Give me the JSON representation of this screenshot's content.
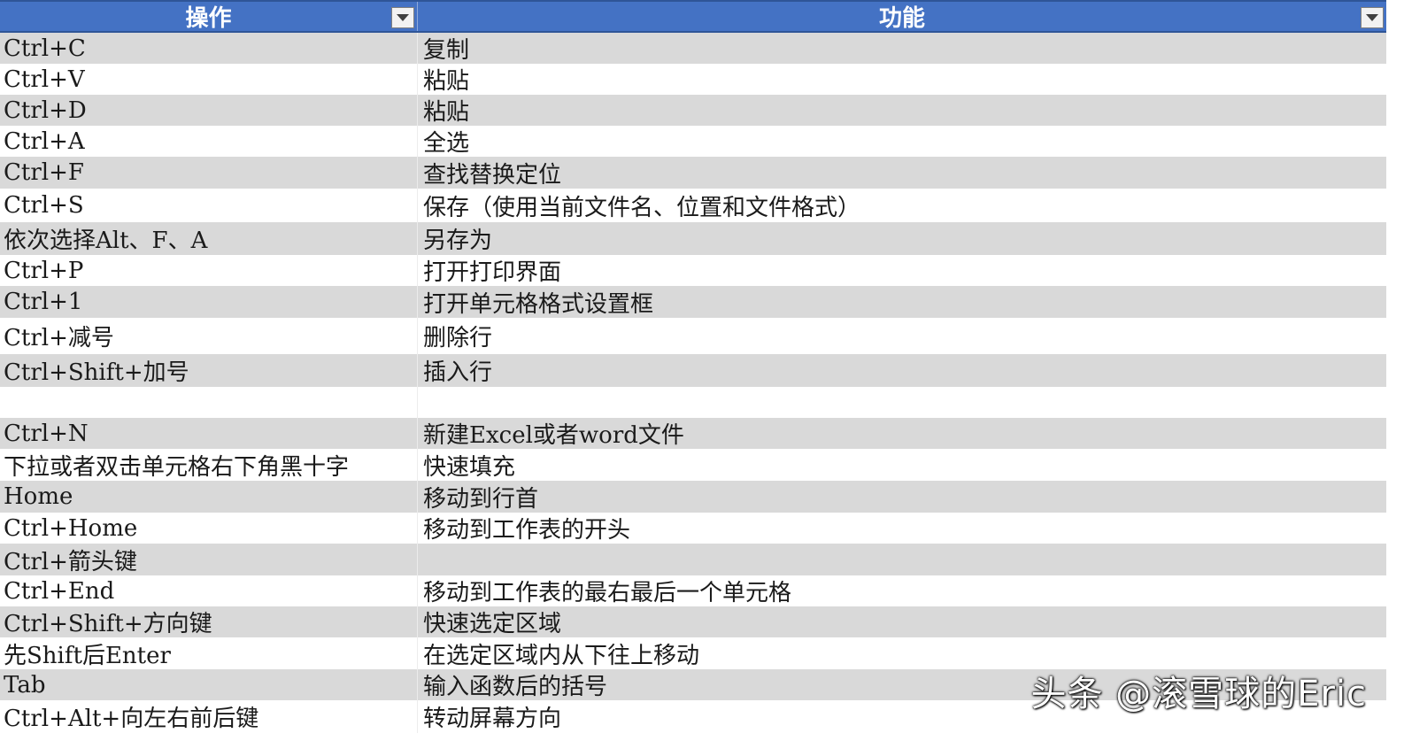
{
  "header": {
    "col1": "操作",
    "col2": "功能"
  },
  "rows": [
    {
      "key": "Ctrl+C",
      "desc": "复制"
    },
    {
      "key": "Ctrl+V",
      "desc": "粘贴"
    },
    {
      "key": "Ctrl+D",
      "desc": "粘贴"
    },
    {
      "key": "Ctrl+A",
      "desc": "全选"
    },
    {
      "key": "Ctrl+F",
      "desc": "查找替换定位"
    },
    {
      "key": "Ctrl+S",
      "desc": "保存（使用当前文件名、位置和文件格式）"
    },
    {
      "key": "依次选择Alt、F、A",
      "desc": "另存为"
    },
    {
      "key": "Ctrl+P",
      "desc": "打开打印界面"
    },
    {
      "key": "Ctrl+1",
      "desc": "打开单元格格式设置框"
    },
    {
      "key": "Ctrl+减号",
      "desc": "删除行"
    },
    {
      "key": "Ctrl+Shift+加号",
      "desc": "插入行"
    },
    {
      "key": "",
      "desc": ""
    },
    {
      "key": "Ctrl+N",
      "desc": "新建Excel或者word文件"
    },
    {
      "key": "下拉或者双击单元格右下角黑十字",
      "desc": "快速填充"
    },
    {
      "key": "Home",
      "desc": "移动到行首"
    },
    {
      "key": "Ctrl+Home",
      "desc": "移动到工作表的开头"
    },
    {
      "key": "Ctrl+箭头键",
      "desc": ""
    },
    {
      "key": "Ctrl+End",
      "desc": "移动到工作表的最右最后一个单元格"
    },
    {
      "key": "Ctrl+Shift+方向键",
      "desc": "快速选定区域"
    },
    {
      "key": "先Shift后Enter",
      "desc": "在选定区域内从下往上移动"
    },
    {
      "key": "Tab",
      "desc": "输入函数后的括号"
    },
    {
      "key": "Ctrl+Alt+向左右前后键",
      "desc": "转动屏幕方向"
    }
  ],
  "watermark": "头条 @滚雪球的Eric"
}
